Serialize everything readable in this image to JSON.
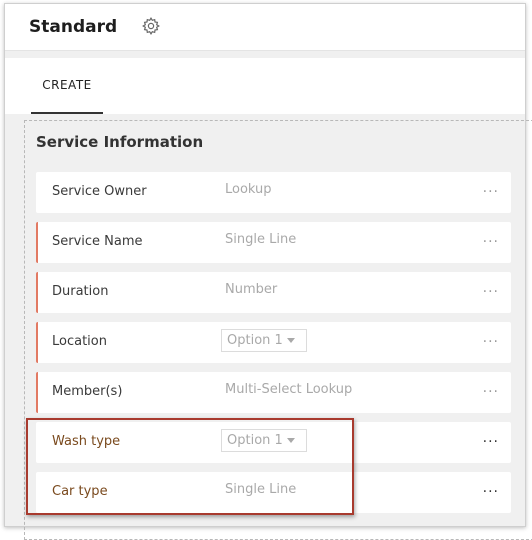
{
  "header": {
    "title": "Standard",
    "settings_icon": "gear-icon"
  },
  "tabs": [
    {
      "label": "CREATE",
      "active": true
    }
  ],
  "section": {
    "title": "Service Information",
    "fields": [
      {
        "label": "Service Owner",
        "type": "Lookup",
        "mandatory": false,
        "more": "···"
      },
      {
        "label": "Service Name",
        "type": "Single Line",
        "mandatory": true,
        "more": "···"
      },
      {
        "label": "Duration",
        "type": "Number",
        "mandatory": true,
        "more": "···"
      },
      {
        "label": "Location",
        "type": "Option 1",
        "mandatory": true,
        "more": "···"
      },
      {
        "label": "Member(s)",
        "type": "Multi-Select Lookup",
        "mandatory": true,
        "more": "···"
      },
      {
        "label": "Wash type",
        "type": "Option 1",
        "mandatory": false,
        "more": "···"
      },
      {
        "label": "Car type",
        "type": "Single Line",
        "mandatory": false,
        "more": "···"
      }
    ]
  },
  "colors": {
    "mandatory_marker": "#e27a63",
    "highlight_border": "#a83a2e",
    "highlight_text": "#7a4a1e"
  }
}
